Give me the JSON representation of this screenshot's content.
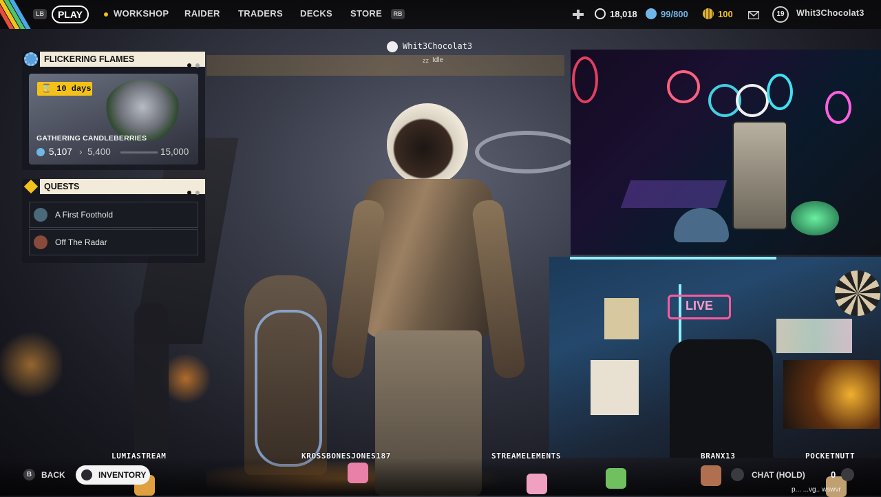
{
  "topbar": {
    "lb_key": "LB",
    "rb_key": "RB",
    "nav": {
      "play": "PLAY",
      "workshop": "WORKSHOP",
      "raider": "RAIDER",
      "traders": "TRADERS",
      "decks": "DECKS",
      "store": "STORE"
    },
    "stats": {
      "coins": "18,018",
      "storage": "99/800",
      "tickets": "100"
    },
    "level": "19",
    "username": "Whit3Chocolat3"
  },
  "player": {
    "name": "Whit3Chocolat3",
    "status": "Idle"
  },
  "event": {
    "title": "FLICKERING FLAMES",
    "days": "10 days",
    "task": "GATHERING CANDLEBERRIES",
    "current": "5,107",
    "next": "5,400",
    "max": "15,000",
    "progress_fraction": 0.34
  },
  "quests": {
    "title": "QUESTS",
    "items": [
      {
        "label": "A First Foothold"
      },
      {
        "label": "Off The Radar"
      }
    ]
  },
  "footer": {
    "b_key": "B",
    "back": "BACK",
    "inventory": "INVENTORY",
    "chat": "CHAT (HOLD)",
    "zero": "0"
  },
  "overlay": {
    "viewers": [
      "LUMIASTREAM",
      "KROSSBONESJONES187",
      "STREAMELEMENTS",
      "BRANX13",
      "POCKETNUTT"
    ],
    "live_sign": "LIVE",
    "chat_fragment": "p... ...vg.. wswvr"
  },
  "colors": {
    "accent": "#f2c21a",
    "panel_header": "#f3ebd9",
    "storage_blue": "#6fb7e8"
  }
}
